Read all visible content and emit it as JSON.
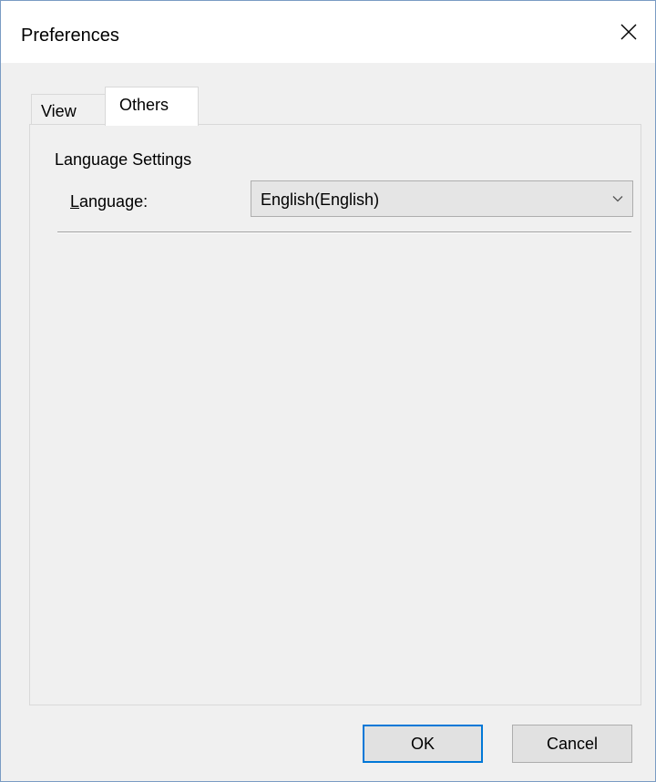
{
  "window": {
    "title": "Preferences"
  },
  "tabs": [
    {
      "label": "View",
      "selected": false
    },
    {
      "label": "Others",
      "selected": true
    }
  ],
  "language_settings": {
    "group_title": "Language Settings",
    "label_accel": "L",
    "label_rest": "anguage:",
    "selected_value": "English(English)"
  },
  "buttons": {
    "ok_label": "OK",
    "cancel_label": "Cancel"
  },
  "icons": {
    "close": "close-icon",
    "dropdown": "chevron-down-icon"
  },
  "colors": {
    "accent": "#0078d7",
    "window_border": "#7a9cc4",
    "background": "#f0f0f0"
  }
}
